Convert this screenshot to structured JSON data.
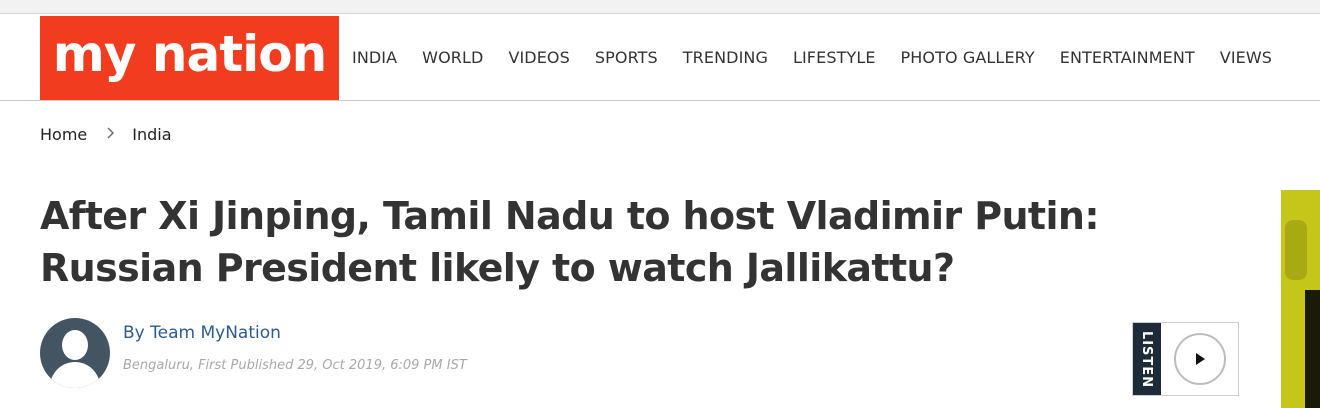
{
  "header": {
    "logo_text": "my nation",
    "logo_color": "#f23c1f",
    "nav": [
      "INDIA",
      "WORLD",
      "VIDEOS",
      "SPORTS",
      "TRENDING",
      "LIFESTYLE",
      "PHOTO GALLERY",
      "ENTERTAINMENT",
      "VIEWS"
    ]
  },
  "breadcrumb": {
    "home": "Home",
    "separator": ">",
    "section": "India"
  },
  "article": {
    "headline": "After Xi Jinping, Tamil Nadu to host Vladimir Putin: Russian President likely to watch Jallikattu?",
    "byline": "By Team MyNation",
    "meta": "Bengaluru, First Published 29, Oct 2019, 6:09 PM IST"
  },
  "listen": {
    "label": "LISTEN",
    "play_icon": "play-icon"
  }
}
